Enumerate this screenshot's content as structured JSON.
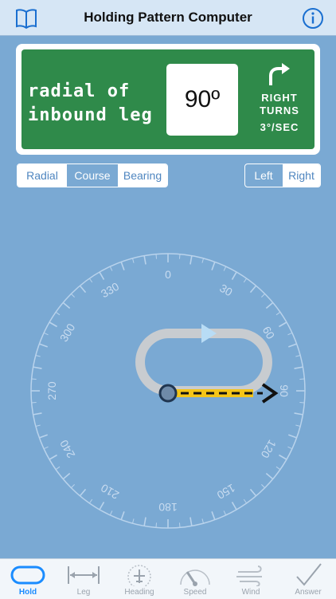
{
  "header": {
    "title": "Holding Pattern Computer",
    "left_icon": "book-icon",
    "right_icon": "info-icon"
  },
  "sign": {
    "line1": "radial of",
    "line2": "inbound leg",
    "value": "90º",
    "turn_line1": "RIGHT",
    "turn_line2": "TURNS",
    "turn_rate": "3°/SEC",
    "color": "#2f8a4a"
  },
  "reference_selector": {
    "options": [
      "Radial",
      "Course",
      "Bearing"
    ],
    "selected": "Course"
  },
  "direction_selector": {
    "options": [
      "Left",
      "Right"
    ],
    "selected": "Left"
  },
  "compass": {
    "labels": [
      "0",
      "30",
      "60",
      "90",
      "120",
      "150",
      "180",
      "210",
      "240",
      "270",
      "300",
      "330"
    ],
    "course_value": 90
  },
  "tabs": [
    {
      "label": "Hold",
      "icon": "hold-icon",
      "active": true
    },
    {
      "label": "Leg",
      "icon": "leg-icon",
      "active": false
    },
    {
      "label": "Heading",
      "icon": "heading-icon",
      "active": false
    },
    {
      "label": "Speed",
      "icon": "speed-icon",
      "active": false
    },
    {
      "label": "Wind",
      "icon": "wind-icon",
      "active": false
    },
    {
      "label": "Answer",
      "icon": "checkmark-icon",
      "active": false
    }
  ],
  "colors": {
    "background": "#7aa9d3",
    "accent": "#1a8cff",
    "inbound_leg": "#f5c518"
  }
}
